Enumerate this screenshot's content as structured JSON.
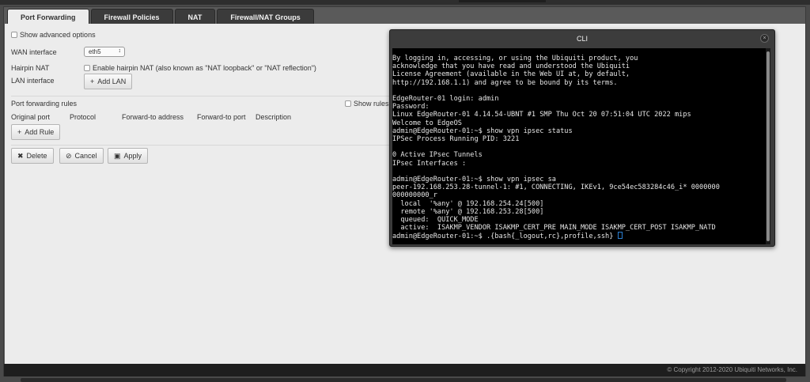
{
  "tabs": [
    {
      "label": "Port Forwarding",
      "active": true
    },
    {
      "label": "Firewall Policies",
      "active": false
    },
    {
      "label": "NAT",
      "active": false
    },
    {
      "label": "Firewall/NAT Groups",
      "active": false
    }
  ],
  "options": {
    "show_advanced": "Show advanced options",
    "wan_interface_label": "WAN interface",
    "wan_interface_value": "eth5",
    "hairpin_label": "Hairpin NAT",
    "hairpin_text": "Enable hairpin NAT (also known as \"NAT loopback\" or \"NAT reflection\")",
    "lan_interface_label": "LAN interface",
    "add_lan": "Add LAN"
  },
  "rules": {
    "title": "Port forwarding rules",
    "show_rules": "Show rules",
    "columns": [
      "Original port",
      "Protocol",
      "Forward-to address",
      "Forward-to port",
      "Description"
    ],
    "add_rule": "Add Rule"
  },
  "actions": {
    "delete": "Delete",
    "cancel": "Cancel",
    "apply": "Apply"
  },
  "icons": {
    "add": "plus-icon",
    "delete": "x-icon",
    "cancel": "cancel-circle-icon",
    "apply": "floppy-icon",
    "close": "close-icon"
  },
  "footer": {
    "copyright": "© Copyright 2012-2020 Ubiquiti Networks, Inc."
  },
  "cli": {
    "title": "CLI",
    "close_glyph": "×",
    "lines": [
      "By logging in, accessing, or using the Ubiquiti product, you",
      "acknowledge that you have read and understood the Ubiquiti",
      "License Agreement (available in the Web UI at, by default,",
      "http://192.168.1.1) and agree to be bound by its terms.",
      "",
      "EdgeRouter-01 login: admin",
      "Password:",
      "Linux EdgeRouter-01 4.14.54-UBNT #1 SMP Thu Oct 20 07:51:04 UTC 2022 mips",
      "Welcome to EdgeOS",
      "admin@EdgeRouter-01:~$ show vpn ipsec status",
      "IPSec Process Running PID: 3221",
      "",
      "0 Active IPsec Tunnels",
      "IPsec Interfaces :",
      "",
      "admin@EdgeRouter-01:~$ show vpn ipsec sa",
      "peer-192.168.253.28-tunnel-1: #1, CONNECTING, IKEv1, 9ce54ec583284c46_i* 0000000",
      "000000000_r",
      "  local  '%any' @ 192.168.254.24[500]",
      "  remote '%any' @ 192.168.253.28[500]",
      "  queued:  QUICK_MODE",
      "  active:  ISAKMP_VENDOR ISAKMP_CERT_PRE MAIN_MODE ISAKMP_CERT_POST ISAKMP_NATD",
      "admin@EdgeRouter-01:~$ .{bash{_logout,rc},profile,ssh} "
    ]
  },
  "colors": {
    "panel_bg": "#ececec",
    "tab_bg": "#3b3b3b",
    "terminal_bg": "#000000",
    "cursor": "#2b7fd1"
  }
}
